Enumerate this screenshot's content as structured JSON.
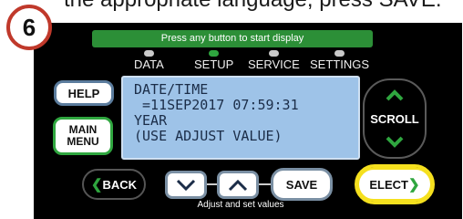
{
  "instruction_text": "the appropriate language, press SAVE.",
  "step_number": "6",
  "banner": "Press any button to start display",
  "tabs": [
    {
      "label": "DATA",
      "active": false
    },
    {
      "label": "SETUP",
      "active": true
    },
    {
      "label": "SERVICE",
      "active": false
    },
    {
      "label": "SETTINGS",
      "active": false
    }
  ],
  "screen_lines": [
    "DATE/TIME",
    " =11SEP2017 07:59:31",
    "YEAR",
    "(USE ADJUST VALUE)"
  ],
  "buttons": {
    "help": "HELP",
    "main_menu_line1": "MAIN",
    "main_menu_line2": "MENU",
    "scroll": "SCROLL",
    "back": "BACK",
    "save": "SAVE",
    "select": "ELECT"
  },
  "caption": "Adjust and set values",
  "colors": {
    "green": "#2fa63f",
    "highlight": "#f5e01e",
    "screen": "#9ec3e8"
  }
}
